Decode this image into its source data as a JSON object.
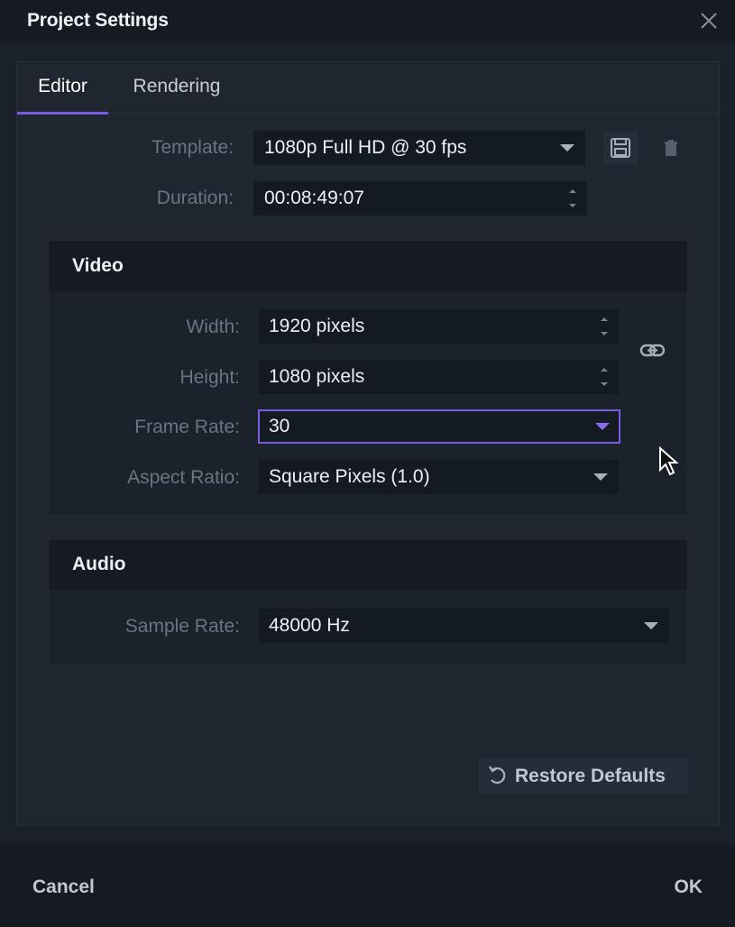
{
  "dialog": {
    "title": "Project Settings"
  },
  "tabs": [
    {
      "label": "Editor",
      "active": true
    },
    {
      "label": "Rendering",
      "active": false
    }
  ],
  "general": {
    "template_label": "Template:",
    "template_value": "1080p Full HD @ 30 fps",
    "duration_label": "Duration:",
    "duration_value": "00:08:49:07"
  },
  "video": {
    "title": "Video",
    "width_label": "Width:",
    "width_value": "1920 pixels",
    "height_label": "Height:",
    "height_value": "1080 pixels",
    "frame_rate_label": "Frame Rate:",
    "frame_rate_value": "30",
    "aspect_ratio_label": "Aspect Ratio:",
    "aspect_ratio_value": "Square Pixels (1.0)"
  },
  "audio": {
    "title": "Audio",
    "sample_rate_label": "Sample Rate:",
    "sample_rate_value": "48000 Hz"
  },
  "actions": {
    "restore_defaults": "Restore Defaults",
    "cancel": "Cancel",
    "ok": "OK"
  },
  "icons": {
    "close": "close-icon",
    "save": "save-icon",
    "delete": "trash-icon",
    "link": "link-icon",
    "restore": "restore-icon",
    "cursor": "mouse-cursor-icon"
  },
  "colors": {
    "accent": "#7b5ce0",
    "background": "#1b212b",
    "field": "#141a22"
  }
}
